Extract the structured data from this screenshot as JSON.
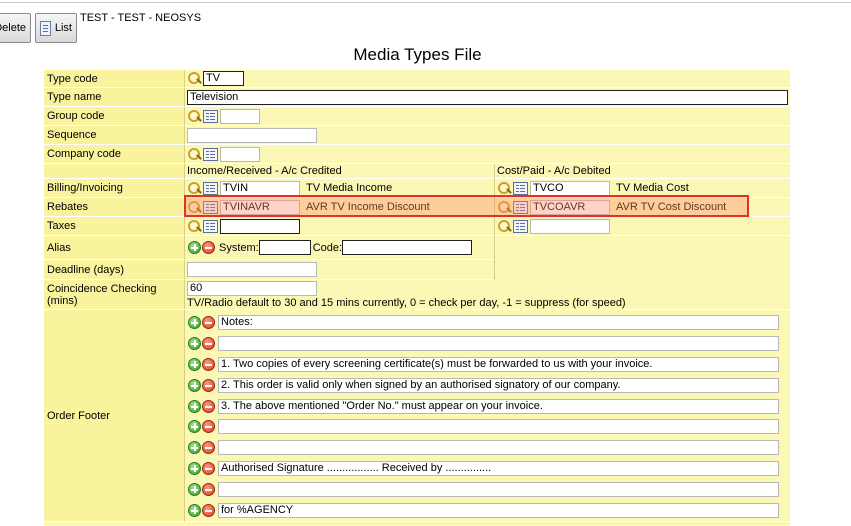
{
  "toolbar": {
    "delete_label": "Delete",
    "list_label": "List"
  },
  "database": "TEST - TEST - NEOSYS",
  "page_title": "Media Types File",
  "fields": {
    "type_code": {
      "label": "Type code",
      "value": "TV"
    },
    "type_name": {
      "label": "Type name",
      "value": "Television"
    },
    "group_code": {
      "label": "Group code",
      "value": ""
    },
    "sequence": {
      "label": "Sequence",
      "value": ""
    },
    "company_code": {
      "label": "Company code",
      "value": ""
    }
  },
  "columns": {
    "income": "Income/Received - A/c Credited",
    "cost": "Cost/Paid - A/c Debited"
  },
  "accounts": {
    "billing": {
      "label": "Billing/Invoicing",
      "income_code": "TVIN",
      "income_name": "TV Media Income",
      "cost_code": "TVCO",
      "cost_name": "TV Media Cost"
    },
    "rebates": {
      "label": "Rebates",
      "income_code": "TVINAVR",
      "income_name": "AVR TV Income Discount",
      "cost_code": "TVCOAVR",
      "cost_name": "AVR TV Cost Discount"
    },
    "taxes": {
      "label": "Taxes",
      "income_code": "",
      "cost_code": ""
    }
  },
  "alias": {
    "label": "Alias",
    "system_label": "System:",
    "system_value": "",
    "code_label": "Code:",
    "code_value": ""
  },
  "deadline": {
    "label": "Deadline (days)",
    "value": ""
  },
  "coincidence": {
    "label": "Coincidence Checking (mins)",
    "value": "60",
    "note": "TV/Radio default to 30 and 15 mins currently, 0 = check per day, -1 = suppress (for speed)"
  },
  "order_footer": {
    "label": "Order Footer",
    "lines": [
      "Notes:",
      "",
      "1. Two copies of every screening certificate(s) must be forwarded to us with your invoice.",
      "2. This order is valid only when signed by an authorised signatory of our company.",
      "3. The above mentioned \"Order No.\" must appear on your invoice.",
      "",
      "",
      "Authorised Signature ................. Received by ...............",
      "",
      "for %AGENCY"
    ]
  }
}
